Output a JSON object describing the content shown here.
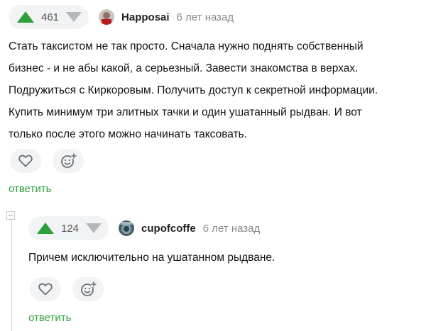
{
  "comments": [
    {
      "votes": "461",
      "author": "Happosai",
      "time": "6 лет назад",
      "text_lines": [
        "Стать таксистом не так просто. Сначала нужно поднять собственный",
        "бизнес - и не абы какой, а серьезный. Завести знакомства в верхах.",
        "Подружиться с Киркоровым. Получить доступ к секретной информации.",
        "Купить минимум три элитных тачки и один ушатанный рыдван. И вот",
        "только после этого можно начинать таксовать."
      ],
      "reply_label": "ответить"
    },
    {
      "votes": "124",
      "author": "cupofcoffe",
      "time": "6 лет назад",
      "text_lines": [
        "Причем исключительно на ушатанном рыдване."
      ],
      "reply_label": "ответить"
    }
  ],
  "colors": {
    "accent": "#2e9f3b",
    "button_bg": "#f2f3f5",
    "muted": "#888888"
  },
  "icons": [
    "arrow-up-icon",
    "arrow-down-icon",
    "heart-icon",
    "emoji-add-icon",
    "collapse-icon"
  ]
}
